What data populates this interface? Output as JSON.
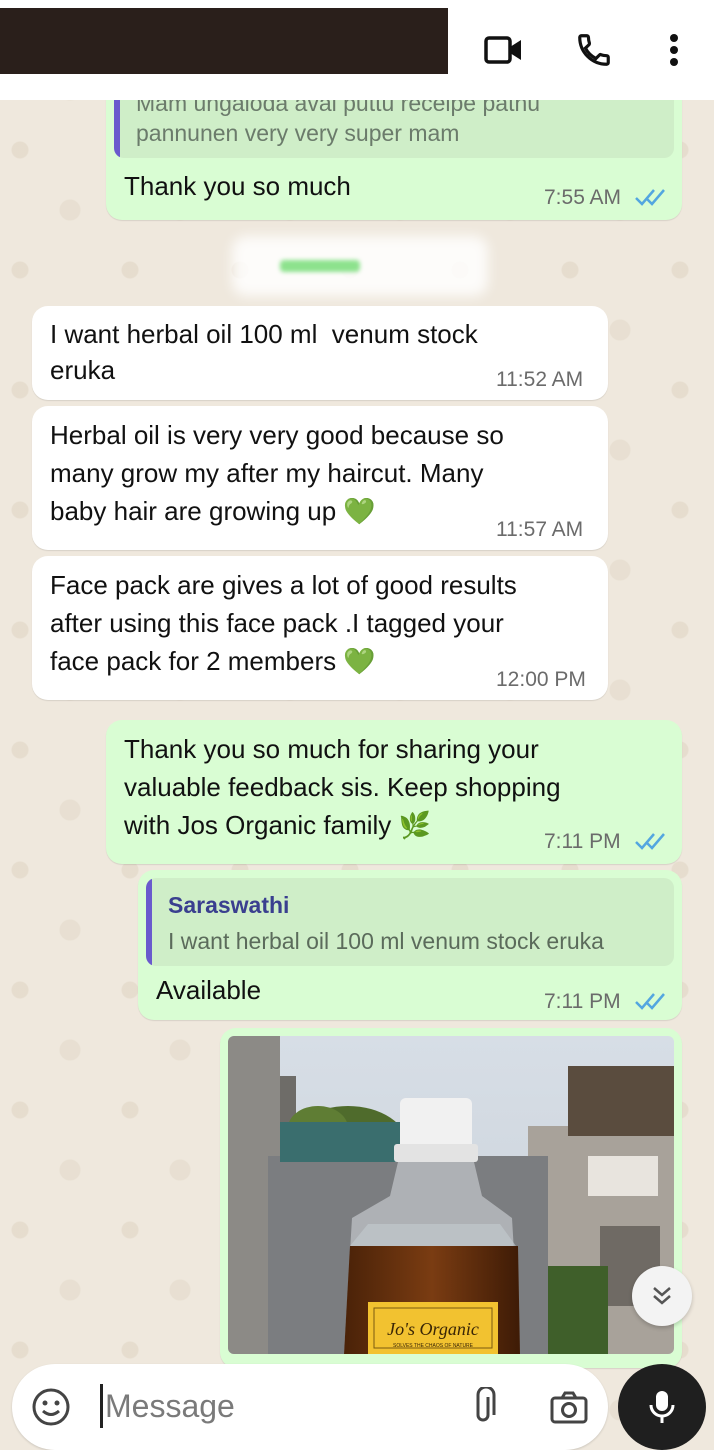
{
  "header": {
    "video_icon": "video-camera-icon",
    "call_icon": "phone-icon",
    "menu_icon": "more-vertical-icon"
  },
  "messages": [
    {
      "id": "m1",
      "quote_text_line1": "Mam ungaloda aval puttu receipe pathu",
      "quote_text_line2": "pannunen very very super mam",
      "text": "Thank you so much",
      "time": "7:55 AM",
      "read": true
    },
    {
      "id": "m2",
      "text": "I want herbal oil 100 ml  venum stock\neruka",
      "time": "11:52 AM"
    },
    {
      "id": "m3",
      "text": "Herbal oil is very very good because so\nmany grow my after my haircut. Many\nbaby hair are growing up 💚",
      "time": "11:57 AM"
    },
    {
      "id": "m4",
      "text": "Face pack are gives a lot of good results\nafter using this face pack .I tagged your\nface pack for 2 members 💚",
      "time": "12:00 PM"
    },
    {
      "id": "m5",
      "text": "Thank you so much for sharing your\nvaluable feedback sis. Keep shopping\nwith Jos Organic family 🌿",
      "time": "7:11 PM",
      "read": true
    },
    {
      "id": "m6",
      "quote_name": "Saraswathi",
      "quote_text": "I want herbal oil 100 ml  venum stock eruka",
      "text": "Available",
      "time": "7:11 PM",
      "read": true
    }
  ],
  "photo": {
    "label_brand": "Jo's Organic",
    "label_tagline": "SOLVES THE CHAOS OF NATURE"
  },
  "composer": {
    "placeholder": "Message",
    "emoji_icon": "emoji-icon",
    "attach_icon": "paperclip-icon",
    "camera_icon": "camera-icon",
    "mic_icon": "microphone-icon"
  },
  "scroll_icon": "double-chevron-down-icon",
  "colors": {
    "outgoing": "#d9fdd3",
    "incoming": "#ffffff",
    "read_ticks": "#53a6e0",
    "quote_bar": "#6a5acd"
  }
}
